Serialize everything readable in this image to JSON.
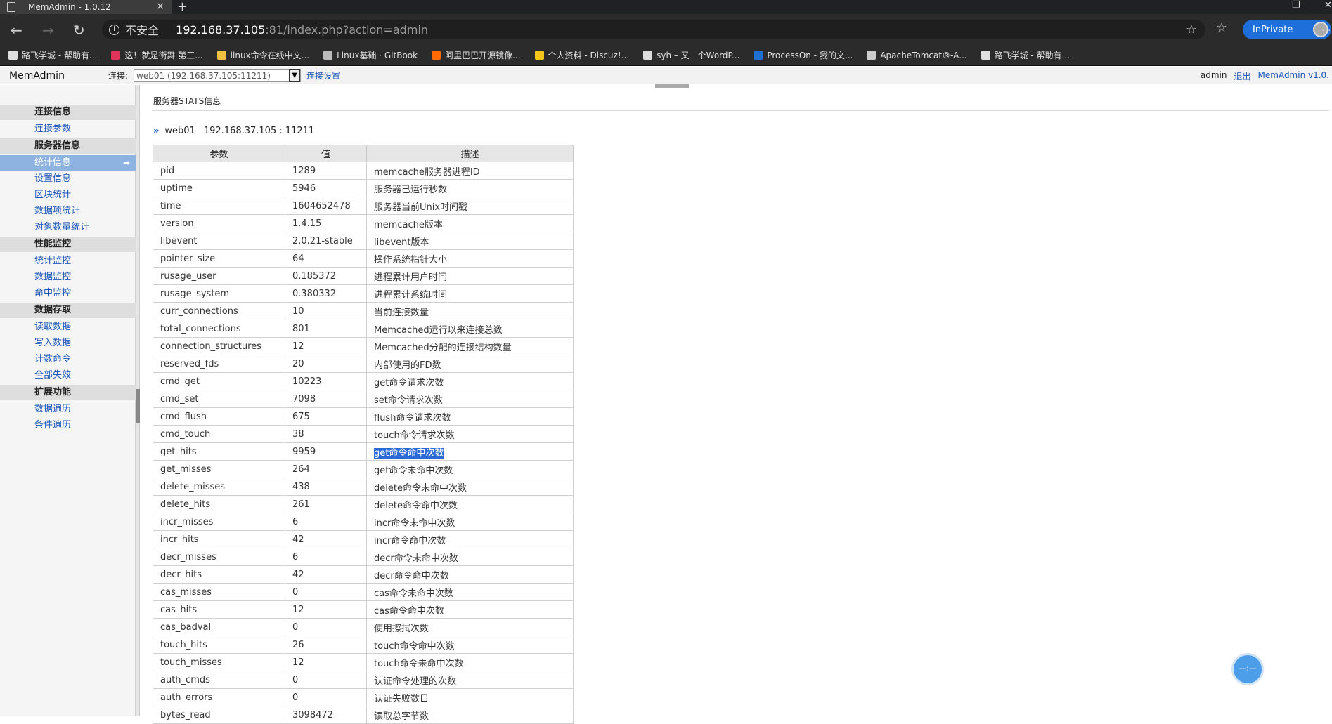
{
  "browser": {
    "tab_title": "MemAdmin - 1.0.12",
    "tab_close": "×",
    "new_tab": "+",
    "url_insecure": "不安全",
    "url_host": "192.168.37.105",
    "url_rest": ":81/index.php?action=admin",
    "inprivate_label": "InPrivate",
    "more": "...",
    "bookmarks": [
      {
        "label": "路飞学城 - 帮助有...",
        "color": "#e0e0e0"
      },
      {
        "label": "这！就是街舞 第三...",
        "color": "#e0335a"
      },
      {
        "label": "linux命令在线中文...",
        "color": "#f0c040"
      },
      {
        "label": "Linux基础 · GitBook",
        "color": "#bbbbbb"
      },
      {
        "label": "阿里巴巴开源镜像...",
        "color": "#ff6a00"
      },
      {
        "label": "个人资料 - Discuz!...",
        "color": "#f5c518"
      },
      {
        "label": "syh – 又一个WordP...",
        "color": "#dddddd"
      },
      {
        "label": "ProcessOn - 我的文...",
        "color": "#1f6fd1"
      },
      {
        "label": "ApacheTomcat®-A...",
        "color": "#cccccc"
      },
      {
        "label": "路飞学城 - 帮助有...",
        "color": "#e0e0e0"
      }
    ]
  },
  "header": {
    "app_title": "MemAdmin",
    "conn_label": "连接:",
    "conn_value": "web01 (192.168.37.105:11211)",
    "conn_dropdown": "▼",
    "conn_settings": "连接设置",
    "user": "admin",
    "logout": "退出",
    "version": "MemAdmin v1.0."
  },
  "sidebar": {
    "groups": [
      {
        "label": "连接信息",
        "items": [
          {
            "label": "连接参数"
          }
        ]
      },
      {
        "label": "服务器信息",
        "items": [
          {
            "label": "统计信息",
            "active": true
          },
          {
            "label": "设置信息"
          },
          {
            "label": "区块统计"
          },
          {
            "label": "数据项统计"
          },
          {
            "label": "对象数量统计"
          }
        ]
      },
      {
        "label": "性能监控",
        "items": [
          {
            "label": "统计监控"
          },
          {
            "label": "数据监控"
          },
          {
            "label": "命中监控"
          }
        ]
      },
      {
        "label": "数据存取",
        "items": [
          {
            "label": "读取数据"
          },
          {
            "label": "写入数据"
          },
          {
            "label": "计数命令"
          },
          {
            "label": "全部失效"
          }
        ]
      },
      {
        "label": "扩展功能",
        "items": [
          {
            "label": "数据遍历"
          },
          {
            "label": "条件遍历"
          }
        ]
      }
    ]
  },
  "main": {
    "section_title": "服务器STATS信息",
    "server_chevron": "»",
    "server_name": "web01",
    "server_addr": "192.168.37.105 : 11211",
    "columns": [
      "参数",
      "值",
      "描述"
    ],
    "rows": [
      [
        "pid",
        "1289",
        "memcache服务器进程ID"
      ],
      [
        "uptime",
        "5946",
        "服务器已运行秒数"
      ],
      [
        "time",
        "1604652478",
        "服务器当前Unix时间戳"
      ],
      [
        "version",
        "1.4.15",
        "memcache版本"
      ],
      [
        "libevent",
        "2.0.21-stable",
        "libevent版本"
      ],
      [
        "pointer_size",
        "64",
        "操作系统指针大小"
      ],
      [
        "rusage_user",
        "0.185372",
        "进程累计用户时间"
      ],
      [
        "rusage_system",
        "0.380332",
        "进程累计系统时间"
      ],
      [
        "curr_connections",
        "10",
        "当前连接数量"
      ],
      [
        "total_connections",
        "801",
        "Memcached运行以来连接总数"
      ],
      [
        "connection_structures",
        "12",
        "Memcached分配的连接结构数量"
      ],
      [
        "reserved_fds",
        "20",
        "内部使用的FD数"
      ],
      [
        "cmd_get",
        "10223",
        "get命令请求次数"
      ],
      [
        "cmd_set",
        "7098",
        "set命令请求次数"
      ],
      [
        "cmd_flush",
        "675",
        "flush命令请求次数"
      ],
      [
        "cmd_touch",
        "38",
        "touch命令请求次数"
      ],
      [
        "get_hits",
        "9959",
        "get命令命中次数"
      ],
      [
        "get_misses",
        "264",
        "get命令未命中次数"
      ],
      [
        "delete_misses",
        "438",
        "delete命令未命中次数"
      ],
      [
        "delete_hits",
        "261",
        "delete命令命中次数"
      ],
      [
        "incr_misses",
        "6",
        "incr命令未命中次数"
      ],
      [
        "incr_hits",
        "42",
        "incr命令命中次数"
      ],
      [
        "decr_misses",
        "6",
        "decr命令未命中次数"
      ],
      [
        "decr_hits",
        "42",
        "decr命令命中次数"
      ],
      [
        "cas_misses",
        "0",
        "cas命令未命中次数"
      ],
      [
        "cas_hits",
        "12",
        "cas命令命中次数"
      ],
      [
        "cas_badval",
        "0",
        "使用擦拭次数"
      ],
      [
        "touch_hits",
        "26",
        "touch命令命中次数"
      ],
      [
        "touch_misses",
        "12",
        "touch命令未命中次数"
      ],
      [
        "auth_cmds",
        "0",
        "认证命令处理的次数"
      ],
      [
        "auth_errors",
        "0",
        "认证失败数目"
      ],
      [
        "bytes_read",
        "3098472",
        "读取总字节数"
      ]
    ],
    "selected_cell": "get命令命中次数"
  }
}
